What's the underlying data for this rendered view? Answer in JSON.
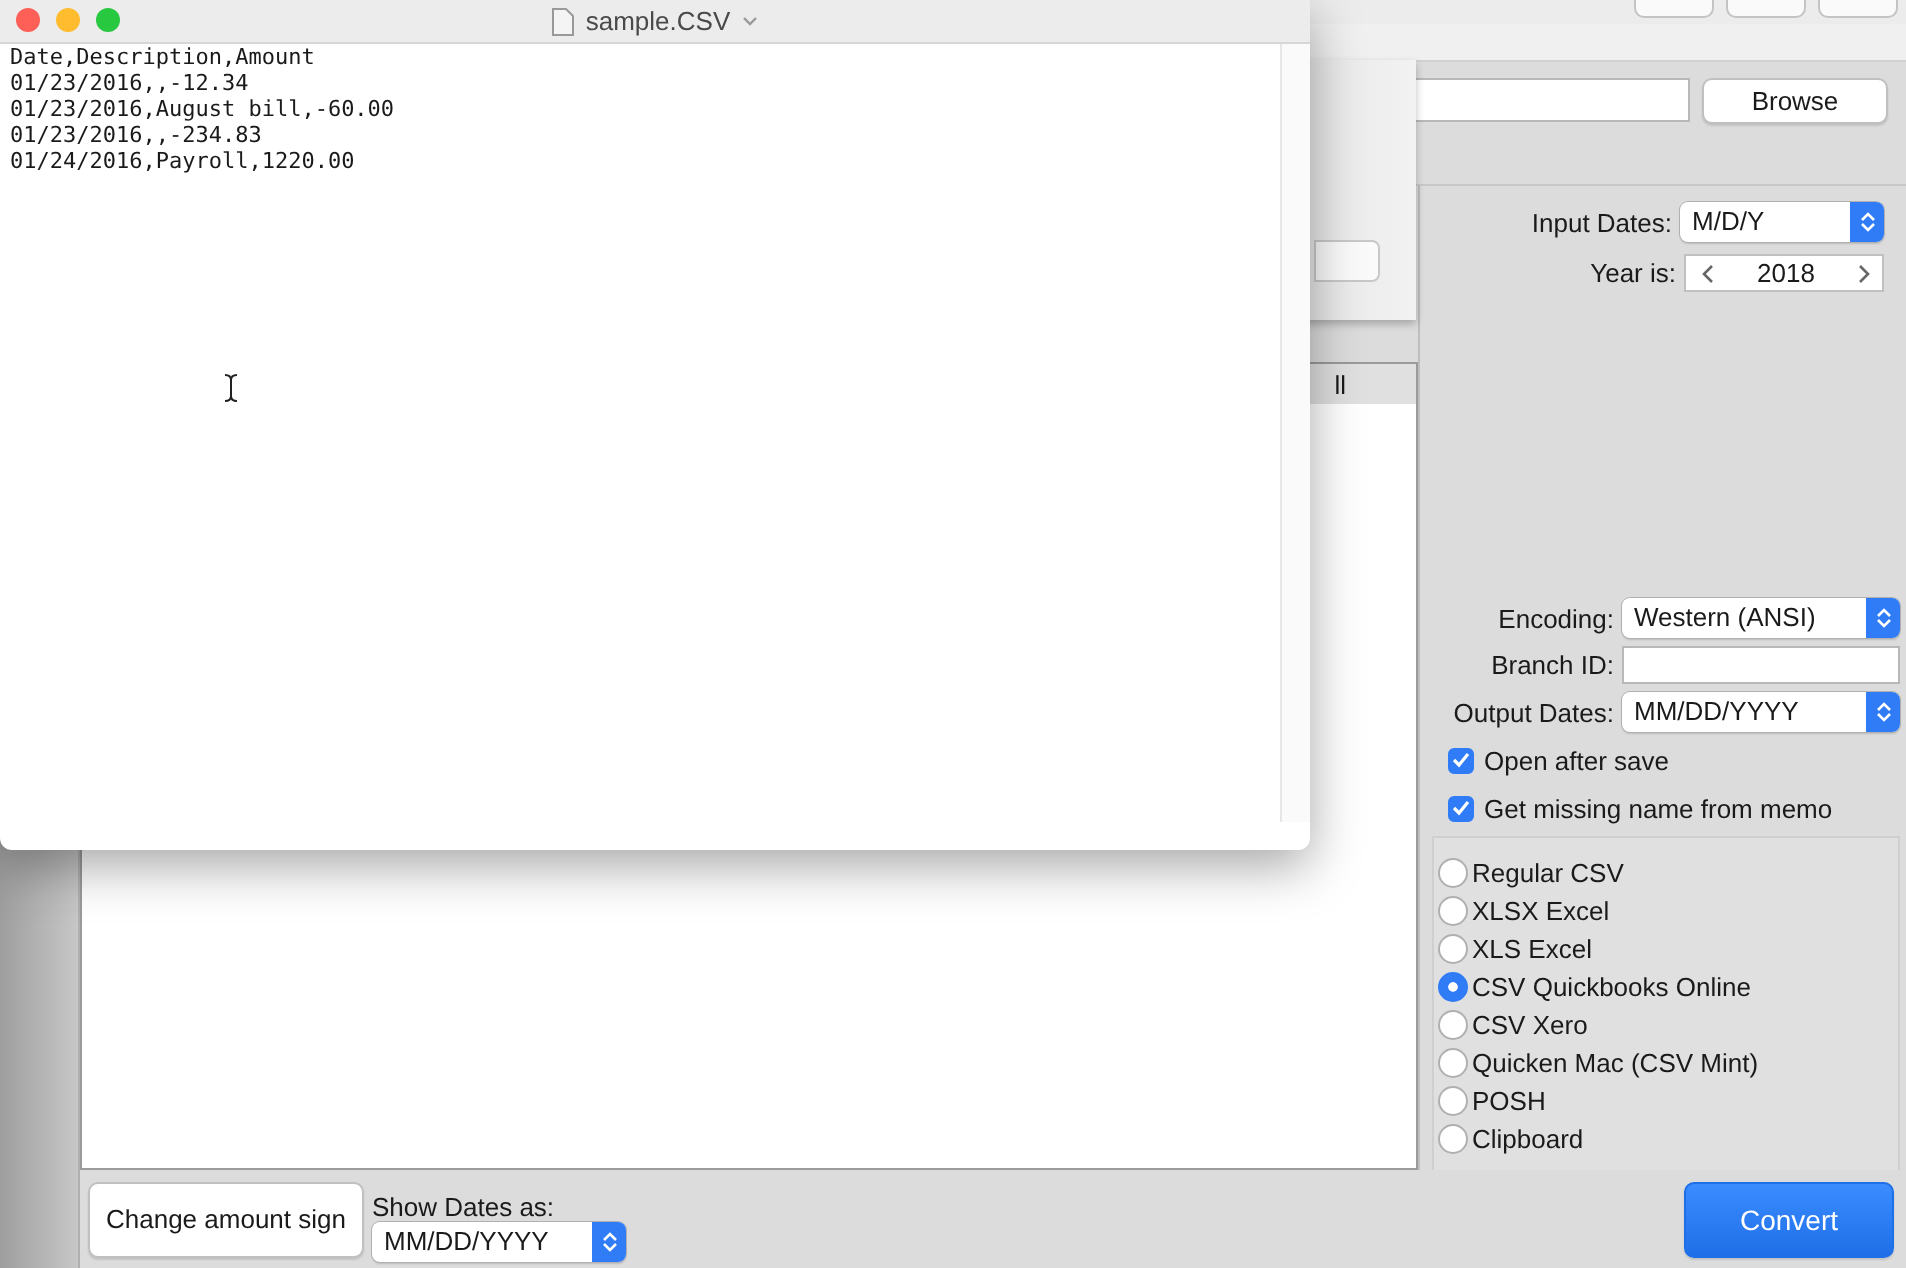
{
  "text_window": {
    "title": "sample.CSV",
    "lines": [
      "Date,Description,Amount",
      "01/23/2016,,-12.34",
      "01/23/2016,August bill,-60.00",
      "01/23/2016,,-234.83",
      "01/24/2016,Payroll,1220.00"
    ]
  },
  "app": {
    "browse_button": "Browse",
    "list_rows": [
      {
        "cell": "ll",
        "selected": true
      }
    ],
    "settings": {
      "input_dates": {
        "label": "Input Dates:",
        "value": "M/D/Y"
      },
      "year": {
        "label": "Year is:",
        "value": "2018"
      },
      "encoding": {
        "label": "Encoding:",
        "value": "Western (ANSI)"
      },
      "branch_id": {
        "label": "Branch ID:"
      },
      "output_dates": {
        "label": "Output Dates:",
        "value": "MM/DD/YYYY"
      },
      "checkboxes": [
        {
          "label": "Open after save",
          "checked": true
        },
        {
          "label": "Get missing name from memo",
          "checked": true
        }
      ],
      "formats": [
        {
          "label": "Regular CSV",
          "selected": false
        },
        {
          "label": "XLSX Excel",
          "selected": false
        },
        {
          "label": "XLS Excel",
          "selected": false
        },
        {
          "label": "CSV Quickbooks Online",
          "selected": true
        },
        {
          "label": "CSV Xero",
          "selected": false
        },
        {
          "label": "Quicken Mac (CSV Mint)",
          "selected": false
        },
        {
          "label": "POSH",
          "selected": false
        },
        {
          "label": "Clipboard",
          "selected": false
        }
      ]
    },
    "bottom": {
      "change_sign_button": "Change amount sign",
      "show_dates": {
        "label": "Show Dates as:",
        "value": "MM/DD/YYYY"
      },
      "convert_button": "Convert"
    }
  }
}
